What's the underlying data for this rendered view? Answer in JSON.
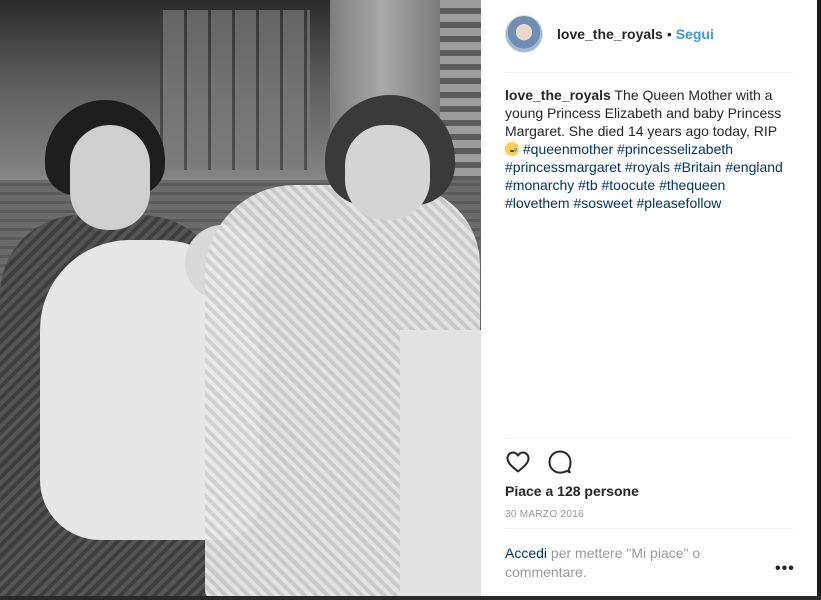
{
  "post": {
    "username": "love_the_royals",
    "separator": "•",
    "follow_label": "Segui"
  },
  "caption": {
    "username": "love_the_royals",
    "text": "The Queen Mother with a young Princess Elizabeth and baby Princess Margaret. She died 14 years ago today, RIP",
    "emoji": "crying-face-emoji",
    "hashtags": "#queenmother #princesselizabeth #princessmargaret #royals #Britain #england #monarchy #tb #toocute #thequeen #lovethem #sosweet #pleasefollow"
  },
  "actions": {
    "like_icon": "heart-outline-icon",
    "comment_icon": "comment-bubble-icon"
  },
  "likes": "Piace a 128 persone",
  "date": "30 MARZO 2016",
  "login": {
    "link_label": "Accedi",
    "rest_text": " per mettere \"Mi piace\" o commentare."
  },
  "more_label": "•••",
  "colors": {
    "link": "#003569",
    "follow": "#3897f0",
    "muted": "#999999",
    "text": "#262626"
  }
}
